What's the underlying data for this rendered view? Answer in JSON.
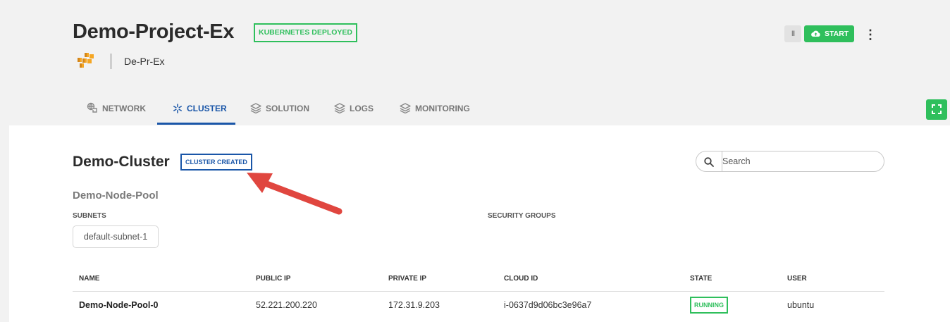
{
  "project": {
    "title": "Demo-Project-Ex",
    "status_badge": "KUBERNETES DEPLOYED",
    "short_name": "De-Pr-Ex",
    "provider_icon": "aws-icon"
  },
  "actions": {
    "pause_label": "II",
    "start_label": "START",
    "more_label": "⋮"
  },
  "tabs": [
    {
      "label": "NETWORK",
      "icon": "network-icon",
      "active": false
    },
    {
      "label": "CLUSTER",
      "icon": "cluster-icon",
      "active": true
    },
    {
      "label": "SOLUTION",
      "icon": "layers-icon",
      "active": false
    },
    {
      "label": "LOGS",
      "icon": "layers-icon",
      "active": false
    },
    {
      "label": "MONITORING",
      "icon": "layers-icon",
      "active": false
    }
  ],
  "cluster": {
    "name": "Demo-Cluster",
    "status_badge": "CLUSTER CREATED",
    "search_placeholder": "Search"
  },
  "node_pool": {
    "name": "Demo-Node-Pool",
    "subnets_label": "SUBNETS",
    "security_groups_label": "SECURITY GROUPS",
    "subnets": [
      "default-subnet-1"
    ]
  },
  "table": {
    "headers": [
      "NAME",
      "PUBLIC IP",
      "PRIVATE IP",
      "CLOUD ID",
      "STATE",
      "USER"
    ],
    "rows": [
      {
        "name": "Demo-Node-Pool-0",
        "public_ip": "52.221.200.220",
        "private_ip": "172.31.9.203",
        "cloud_id": "i-0637d9d06bc3e96a7",
        "state": "RUNNING",
        "user": "ubuntu"
      }
    ]
  },
  "colors": {
    "accent_green": "#2fbf5c",
    "accent_blue": "#1a56a8",
    "annotation_arrow": "#e0463f"
  }
}
